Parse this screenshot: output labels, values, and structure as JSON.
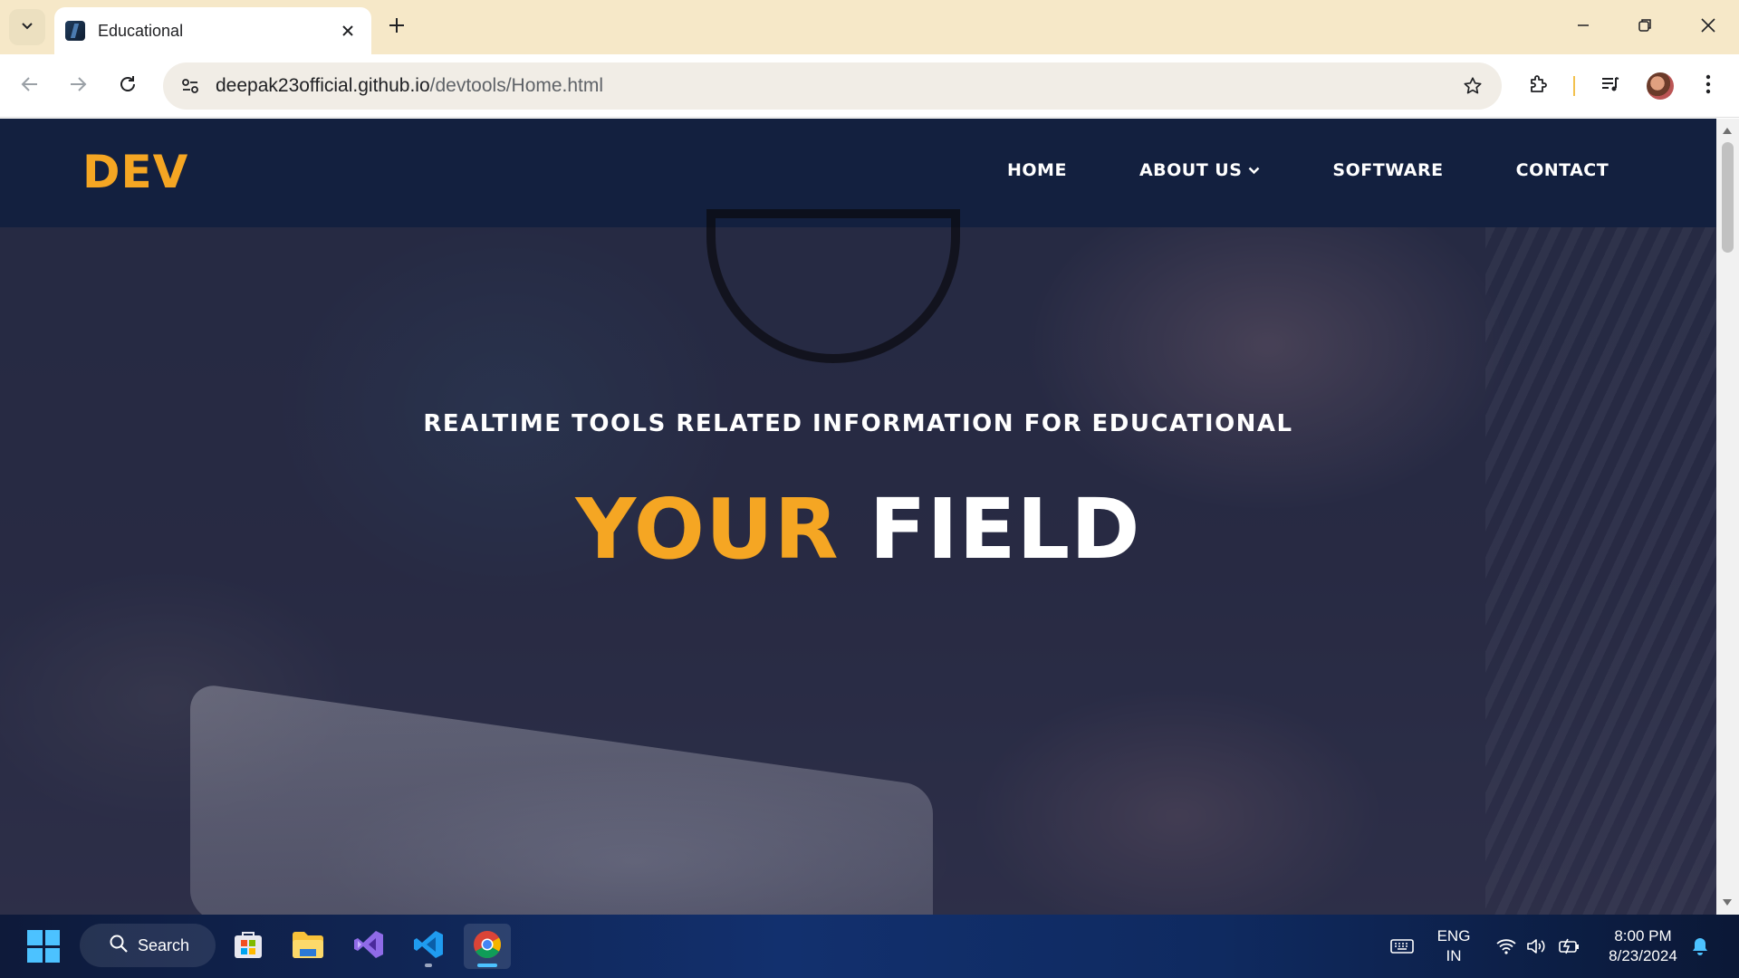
{
  "browser": {
    "tab_title": "Educational",
    "url_host": "deepak23official.github.io",
    "url_path": "/devtools/Home.html"
  },
  "site": {
    "logo": "DEV",
    "nav": [
      {
        "label": "HOME"
      },
      {
        "label": "ABOUT US",
        "has_dropdown": true
      },
      {
        "label": "SOFTWARE"
      },
      {
        "label": "CONTACT"
      }
    ],
    "hero": {
      "subtitle": "REALTIME TOOLS RELATED INFORMATION FOR EDUCATIONAL",
      "headline_accent": "YOUR",
      "headline_rest": "FIELD"
    },
    "colors": {
      "header_bg": "#13203f",
      "accent": "#f5a623",
      "text": "#ffffff"
    }
  },
  "taskbar": {
    "search_label": "Search",
    "apps": [
      "microsoft-store",
      "file-explorer",
      "visual-studio",
      "vscode",
      "chrome"
    ],
    "language_line1": "ENG",
    "language_line2": "IN",
    "time": "8:00 PM",
    "date": "8/23/2024"
  }
}
